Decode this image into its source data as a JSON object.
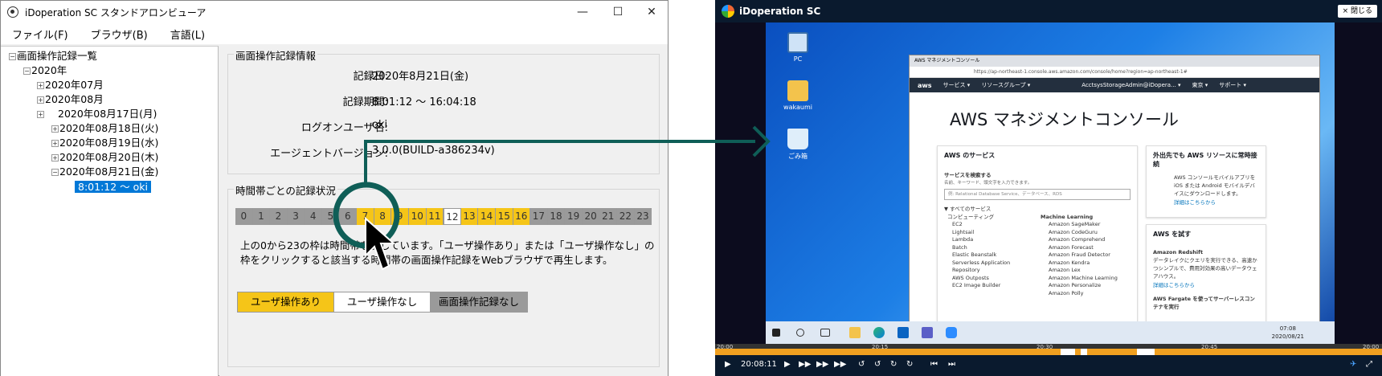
{
  "viewer": {
    "title": "iDoperation SC スタンドアロンビューア",
    "controls": {
      "minimize": "—",
      "maximize": "☐",
      "close": "✕"
    },
    "menu": [
      "ファイル(F)",
      "ブラウザ(B)",
      "言語(L)"
    ]
  },
  "tree": {
    "root": "画面操作記録一覧",
    "year": "2020年",
    "months": [
      "2020年07月",
      "2020年08月"
    ],
    "days": [
      "2020年08月17日(月)",
      "2020年08月18日(火)",
      "2020年08月19日(水)",
      "2020年08月20日(木)",
      "2020年08月21日(金)"
    ],
    "session": "8:01:12 ～ oki"
  },
  "info": {
    "group_title": "画面操作記録情報",
    "date_label": "記録日:",
    "date_value": "2020年8月21日(金)",
    "period_label": "記録期間:",
    "period_value": "8:01:12 ～ 16:04:18",
    "user_label": "ログオンユーザ名:",
    "user_value": "oki",
    "agent_label": "エージェントバージョン:",
    "agent_value": "3.0.0(BUILD-a386234v)"
  },
  "hourly": {
    "group_title": "時間帯ごとの記録状況",
    "hours": [
      {
        "label": "0",
        "status": "none"
      },
      {
        "label": "1",
        "status": "none"
      },
      {
        "label": "2",
        "status": "none"
      },
      {
        "label": "3",
        "status": "none"
      },
      {
        "label": "4",
        "status": "none"
      },
      {
        "label": "5",
        "status": "none"
      },
      {
        "label": "6",
        "status": "none"
      },
      {
        "label": "7",
        "status": "user"
      },
      {
        "label": "8",
        "status": "user"
      },
      {
        "label": "9",
        "status": "user"
      },
      {
        "label": "10",
        "status": "user"
      },
      {
        "label": "11",
        "status": "user"
      },
      {
        "label": "12",
        "status": "idle"
      },
      {
        "label": "13",
        "status": "user"
      },
      {
        "label": "14",
        "status": "user"
      },
      {
        "label": "15",
        "status": "user"
      },
      {
        "label": "16",
        "status": "user"
      },
      {
        "label": "17",
        "status": "none"
      },
      {
        "label": "18",
        "status": "none"
      },
      {
        "label": "19",
        "status": "none"
      },
      {
        "label": "20",
        "status": "none"
      },
      {
        "label": "21",
        "status": "none"
      },
      {
        "label": "22",
        "status": "none"
      },
      {
        "label": "23",
        "status": "none"
      }
    ],
    "desc_line1": "上の0から23の枠は時間帯を表しています。「ユーザ操作あり」または「ユーザ操作なし」の",
    "desc_line2": "枠をクリックすると該当する時間帯の画面操作記録をWebブラウザで再生します。",
    "legend": {
      "user": "ユーザ操作あり",
      "idle": "ユーザ操作なし",
      "none": "画面操作記録なし"
    },
    "colors": {
      "user": "#f5c518",
      "idle": "#ffffff",
      "none": "#9a9a9a"
    }
  },
  "player": {
    "title": "iDoperation SC",
    "close_label": "× 閉じる",
    "desktop_icons": [
      "PC",
      "wakaumi",
      "ごみ箱"
    ],
    "browser": {
      "tab": "AWS マネジメントコンソール",
      "url": "https://ap-northeast-1.console.aws.amazon.com/console/home?region=ap-northeast-1#",
      "nav": [
        "aws",
        "サービス ▾",
        "リソースグループ ▾",
        "AcctsysStorageAdmin@iDopera... ▾",
        "東京 ▾",
        "サポート ▾"
      ],
      "heading": "AWS マネジメントコンソール",
      "services_title": "AWS のサービス",
      "search_title": "サービスを検索する",
      "search_hint": "名前、キーワード、頭文字を入力できます。",
      "search_placeholder": "例: Relational Database Service、データベース、RDS",
      "all_services": "▼ すべてのサービス",
      "compute_title": "コンピューティング",
      "compute": [
        "EC2",
        "Lightsail",
        "Lambda",
        "Batch",
        "Elastic Beanstalk",
        "Serverless Application Repository",
        "AWS Outposts",
        "EC2 Image Builder"
      ],
      "ml_title": "Machine Learning",
      "ml": [
        "Amazon SageMaker",
        "Amazon CodeGuru",
        "Amazon Comprehend",
        "Amazon Forecast",
        "Amazon Fraud Detector",
        "Amazon Kendra",
        "Amazon Lex",
        "Amazon Machine Learning",
        "Amazon Personalize",
        "Amazon Polly"
      ],
      "side1_title": "外出先でも AWS リソースに常時接続",
      "side1_text": "AWS コンソールモバイルアプリを iOS または Android モバイルデバイスにダウンロードします。",
      "side1_link": "詳細はこちらから",
      "side2_title": "AWS を試す",
      "side2_sub": "Amazon Redshift",
      "side2_text": "データレイクにクエリを実行できる、高速かつシンプルで、費用対効果の高いデータウェアハウス。",
      "side2_link": "詳細はこちらから",
      "side3_title": "AWS Fargate を使ってサーバーレスコンテナを実行"
    },
    "clock_time": "07:08",
    "clock_date": "2020/08/21",
    "timeline_labels": [
      "20:00",
      "20:15",
      "20:30",
      "20:45",
      "20:00"
    ],
    "play_time": "20:08:11"
  }
}
